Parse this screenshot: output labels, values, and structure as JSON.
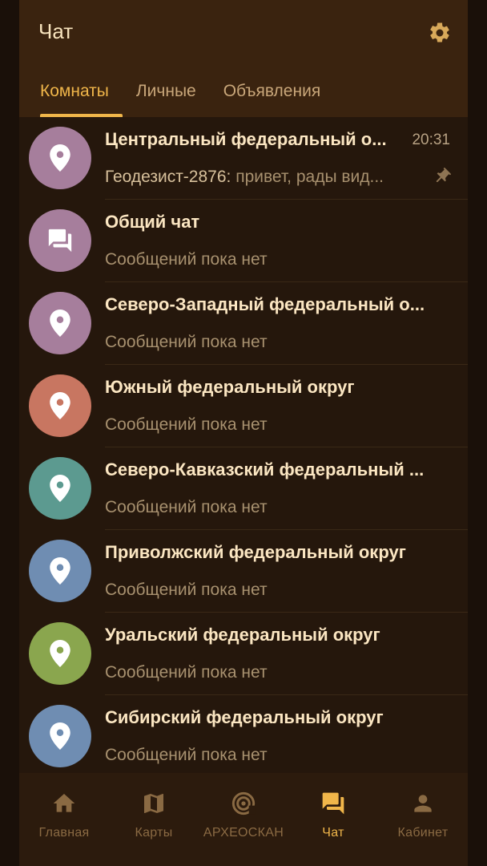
{
  "header": {
    "title": "Чат",
    "settings_icon": "gear-icon"
  },
  "tabs": [
    {
      "label": "Комнаты",
      "active": true
    },
    {
      "label": "Личные",
      "active": false
    },
    {
      "label": "Объявления",
      "active": false
    }
  ],
  "rooms": [
    {
      "title": "Центральный федеральный о...",
      "time": "20:31",
      "sender": "Геодезист-2876:",
      "message": " привет, рады вид...",
      "avatar_color": "#a67e9c",
      "icon": "map-pin-icon",
      "pinned": true
    },
    {
      "title": "Общий чат",
      "subtitle": "Сообщений пока нет",
      "avatar_color": "#a67e9c",
      "icon": "chat-bubbles-icon"
    },
    {
      "title": "Северо-Западный федеральный о...",
      "subtitle": "Сообщений пока нет",
      "avatar_color": "#a67e9c",
      "icon": "map-pin-icon"
    },
    {
      "title": "Южный федеральный округ",
      "subtitle": "Сообщений пока нет",
      "avatar_color": "#c87661",
      "icon": "map-pin-icon"
    },
    {
      "title": "Северо-Кавказский федеральный ...",
      "subtitle": "Сообщений пока нет",
      "avatar_color": "#5c9a90",
      "icon": "map-pin-icon"
    },
    {
      "title": "Приволжский федеральный округ",
      "subtitle": "Сообщений пока нет",
      "avatar_color": "#6f8db2",
      "icon": "map-pin-icon"
    },
    {
      "title": "Уральский федеральный округ",
      "subtitle": "Сообщений пока нет",
      "avatar_color": "#8aa64e",
      "icon": "map-pin-icon"
    },
    {
      "title": "Сибирский федеральный округ",
      "subtitle": "Сообщений пока нет",
      "avatar_color": "#6f8db2",
      "icon": "map-pin-icon"
    }
  ],
  "bottom_nav": [
    {
      "label": "Главная",
      "icon": "home-icon",
      "active": false
    },
    {
      "label": "Карты",
      "icon": "map-icon",
      "active": false
    },
    {
      "label": "АРХЕОСКАН",
      "icon": "scan-target-icon",
      "active": false
    },
    {
      "label": "Чат",
      "icon": "forum-icon",
      "active": true
    },
    {
      "label": "Кабинет",
      "icon": "person-icon",
      "active": false
    }
  ],
  "colors": {
    "accent": "#f0b64a",
    "background": "#25170c",
    "header": "#3a230f",
    "nav_inactive": "#8a6a43"
  }
}
